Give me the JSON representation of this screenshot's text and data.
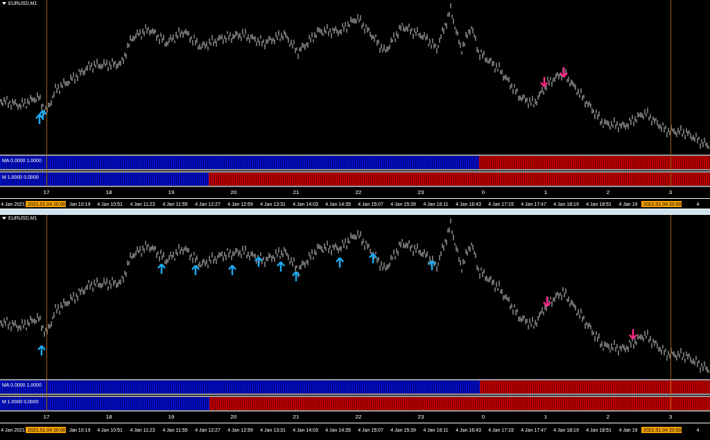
{
  "charts": [
    {
      "title": "EURUSD,M1",
      "indicators": [
        {
          "label": "MA 0.0000 1.0000",
          "level": 0.675
        },
        {
          "label": "M 1.0000 0.0000",
          "level": 0.294
        }
      ],
      "hours": [
        "17",
        "18",
        "19",
        "20",
        "21",
        "22",
        "23",
        "0",
        "1",
        "2",
        "3"
      ],
      "time_axis": [
        {
          "kind": "label",
          "text": "4 Jan 2021"
        },
        {
          "kind": "marker",
          "text": "2021.01.04 10:00"
        },
        {
          "kind": "label",
          "text": "Jan 10:19"
        },
        {
          "kind": "label",
          "text": "4 Jan 10:51"
        },
        {
          "kind": "label",
          "text": "4 Jan 11:23"
        },
        {
          "kind": "label",
          "text": "4 Jan 11:55"
        },
        {
          "kind": "label",
          "text": "4 Jan 12:27"
        },
        {
          "kind": "label",
          "text": "4 Jan 12:59"
        },
        {
          "kind": "label",
          "text": "4 Jan 13:31"
        },
        {
          "kind": "label",
          "text": "4 Jan 14:03"
        },
        {
          "kind": "label",
          "text": "4 Jan 14:35"
        },
        {
          "kind": "label",
          "text": "4 Jan 15:07"
        },
        {
          "kind": "label",
          "text": "4 Jan 15:39"
        },
        {
          "kind": "label",
          "text": "4 Jan 16:11"
        },
        {
          "kind": "label",
          "text": "4 Jan 16:43"
        },
        {
          "kind": "label",
          "text": "4 Jan 17:15"
        },
        {
          "kind": "label",
          "text": "4 Jan 17:47"
        },
        {
          "kind": "label",
          "text": "4 Jan 18:19"
        },
        {
          "kind": "label",
          "text": "4 Jan 18:51"
        },
        {
          "kind": "label",
          "text": "4 Jan 19"
        },
        {
          "kind": "marker",
          "text": "2021.01.04 20:00"
        },
        {
          "kind": "label",
          "text": "4"
        }
      ]
    },
    {
      "title": "EURUSD,M1",
      "indicators": [
        {
          "label": "MA 0.0000 1.0000",
          "level": 0.676
        },
        {
          "label": "M 1.0000 0.0000",
          "level": 0.295
        }
      ],
      "hours": [
        "17",
        "18",
        "19",
        "20",
        "21",
        "22",
        "23",
        "0",
        "1",
        "2",
        "3"
      ],
      "time_axis": [
        {
          "kind": "label",
          "text": "4 Jan 2021"
        },
        {
          "kind": "marker",
          "text": "2021.01.04 10:00"
        },
        {
          "kind": "label",
          "text": "Jan 10:19"
        },
        {
          "kind": "label",
          "text": "4 Jan 10:51"
        },
        {
          "kind": "label",
          "text": "4 Jan 11:23"
        },
        {
          "kind": "label",
          "text": "4 Jan 11:55"
        },
        {
          "kind": "label",
          "text": "4 Jan 12:27"
        },
        {
          "kind": "label",
          "text": "4 Jan 12:59"
        },
        {
          "kind": "label",
          "text": "4 Jan 13:31"
        },
        {
          "kind": "label",
          "text": "4 Jan 14:03"
        },
        {
          "kind": "label",
          "text": "4 Jan 14:35"
        },
        {
          "kind": "label",
          "text": "4 Jan 15:07"
        },
        {
          "kind": "label",
          "text": "4 Jan 15:39"
        },
        {
          "kind": "label",
          "text": "4 Jan 16:11"
        },
        {
          "kind": "label",
          "text": "4 Jan 16:43"
        },
        {
          "kind": "label",
          "text": "4 Jan 17:15"
        },
        {
          "kind": "label",
          "text": "4 Jan 17:47"
        },
        {
          "kind": "label",
          "text": "4 Jan 18:19"
        },
        {
          "kind": "label",
          "text": "4 Jan 18:51"
        },
        {
          "kind": "label",
          "text": "4 Jan 19"
        },
        {
          "kind": "marker",
          "text": "2021.01.04 20:00"
        },
        {
          "kind": "label",
          "text": "4"
        }
      ]
    }
  ]
}
